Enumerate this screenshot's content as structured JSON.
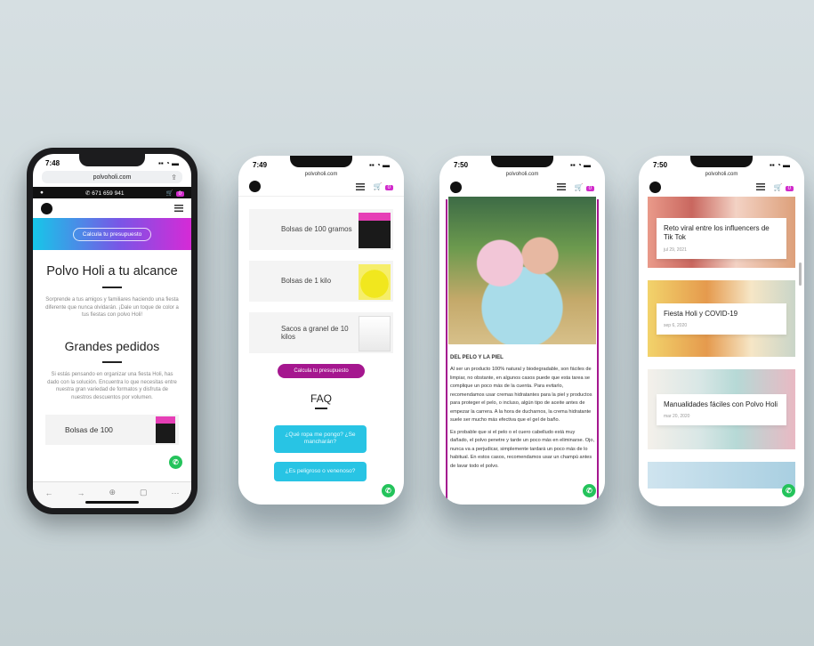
{
  "phone1": {
    "time": "7:48",
    "url": "polvoholi.com",
    "phone_number": "671 659 941",
    "cart_count": "0",
    "cta": "Calcula tu presupuesto",
    "title": "Polvo Holi a tu alcance",
    "intro": "Sorprende a tus amigos y familiares haciendo una fiesta diferente que nunca olvidarán. ¡Dale un toque de color a tus fiestas con polvo Holi!",
    "section_title": "Grandes pedidos",
    "section_text": "Si estás pensando en organizar una fiesta Holi, has dado con la solución. Encuentra lo que necesitas entre nuestra gran variedad de formatos y disfruta de nuestros descuentos por volumen.",
    "product": "Bolsas de 100"
  },
  "phone2": {
    "time": "7:49",
    "url": "polvoholi.com",
    "cart_count": "0",
    "products": [
      "Bolsas de 100 gramos",
      "Bolsas de 1 kilo",
      "Sacos a granel de 10 kilos"
    ],
    "cta": "Calcula tu presupuesto",
    "faq_title": "FAQ",
    "faq_questions": [
      "¿Qué ropa me pongo? ¿Se mancharán?",
      "¿Es peligroso o venenoso?"
    ]
  },
  "phone3": {
    "time": "7:50",
    "url": "polvoholi.com",
    "cart_count": "0",
    "heading": "DEL PELO Y LA PIEL",
    "paragraph1": "Al ser un producto 100% natural y biodegradable, son fáciles de limpiar, no obstante, en algunos casos puede que esta tarea se complique un poco más de la cuenta. Para evitarlo, recomendamos usar cremas hidratantes para la piel y productos para proteger el pelo, o incluso, algún tipo de aceite antes de empezar la carrera. A la hora de ducharnos, la crema hidratante suele ser mucho más efectiva que el gel de baño.",
    "paragraph2": "Es probable que si el pelo o el cuero cabelludo está muy dañado, el polvo penetre y tarde un poco más en eliminarse. Ojo, nunca va a perjudicar, simplemente tardará un poco más de lo habitual. En estos casos, recomendamos usar un champú antes de lavar todo el polvo."
  },
  "phone4": {
    "time": "7:50",
    "url": "polvoholi.com",
    "cart_count": "0",
    "posts": [
      {
        "title": "Reto viral entre los influencers de Tik Tok",
        "date": "jul 29, 2021"
      },
      {
        "title": "Fiesta Holi y COVID-19",
        "date": "sep 6, 2020"
      },
      {
        "title": "Manualidades fáciles con Polvo Holi",
        "date": "mar 20, 2020"
      }
    ]
  },
  "colors": {
    "accent": "#a5178f",
    "magenta": "#d62ad6",
    "cyan": "#28c4e4",
    "whatsapp": "#24c35b"
  }
}
